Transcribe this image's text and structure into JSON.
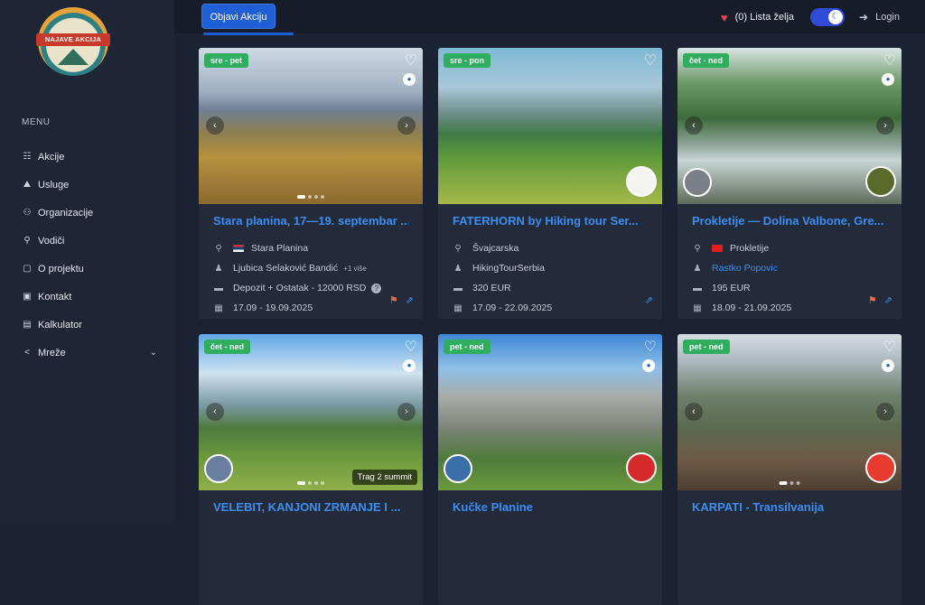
{
  "brand": {
    "logo_text": "NAJAVE AKCIJA"
  },
  "sidebar": {
    "menu_title": "MENU",
    "items": [
      {
        "label": "Akcije",
        "icon": "sliders-icon"
      },
      {
        "label": "Usluge",
        "icon": "hiker-icon"
      },
      {
        "label": "Organizacije",
        "icon": "group-icon"
      },
      {
        "label": "Vodiči",
        "icon": "walking-icon"
      },
      {
        "label": "O projektu",
        "icon": "document-icon"
      },
      {
        "label": "Kontakt",
        "icon": "contact-icon"
      },
      {
        "label": "Kalkulator",
        "icon": "calculator-icon"
      },
      {
        "label": "Mreže",
        "icon": "share-icon"
      }
    ]
  },
  "topbar": {
    "publish_button": "Objavi Akciju",
    "wishlist": "(0) Lista želja",
    "login": "Login"
  },
  "cards": [
    {
      "days": "sre - pet",
      "title": "Stara planina, 17—19. septembar ...",
      "location": "Stara Planina",
      "organizer": "Ljubica Selaković Bandić",
      "organizer_more": "+1 više",
      "price": "Depozit + Ostatak - 12000 RSD",
      "dates": "17.09 - 19.09.2025"
    },
    {
      "days": "sre - pon",
      "title": "FATERHORN by Hiking tour Ser...",
      "location": "Švajcarska",
      "organizer": "HikingTourSerbia",
      "price": "320 EUR",
      "dates": "17.09 - 22.09.2025"
    },
    {
      "days": "čet - ned",
      "title": "Prokletije — Dolina Valbone, Gre...",
      "location": "Prokletije",
      "organizer": "Rastko Popovic",
      "price": "195 EUR",
      "dates": "18.09 - 21.09.2025"
    },
    {
      "days": "čet - ned",
      "title": "VELEBIT, KANJONI ZRMANJE I ...",
      "photo_tag": "Trag 2 summit"
    },
    {
      "days": "pet - ned",
      "title": "Kučke Planine"
    },
    {
      "days": "pet - ned",
      "title": "KARPATI - Transilvanija"
    }
  ],
  "colors": {
    "accent": "#1f5fd6",
    "link": "#3b8df0",
    "badge_green": "#2fae5f",
    "heart": "#e8434a"
  }
}
